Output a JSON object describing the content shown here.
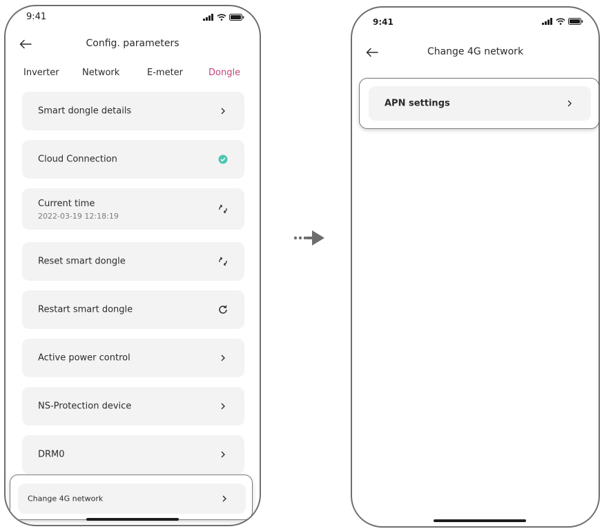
{
  "left_screen": {
    "status": {
      "time": "9:41"
    },
    "title": "Config. parameters",
    "tabs": [
      {
        "label": "Inverter",
        "active": false
      },
      {
        "label": "Network",
        "active": false
      },
      {
        "label": "E-meter",
        "active": false
      },
      {
        "label": "Dongle",
        "active": true
      }
    ],
    "items": [
      {
        "label": "Smart dongle details",
        "trailing_icon": "chevron-right"
      },
      {
        "label": "Cloud Connection",
        "trailing_icon": "check-circle"
      },
      {
        "label": "Current time",
        "value": "2022-03-19 12:18:19",
        "trailing_icon": "sync"
      },
      {
        "label": "Reset smart dongle",
        "trailing_icon": "sync"
      },
      {
        "label": "Restart smart dongle",
        "trailing_icon": "refresh"
      },
      {
        "label": "Active power control",
        "trailing_icon": "chevron-right"
      },
      {
        "label": "NS-Protection device",
        "trailing_icon": "chevron-right"
      },
      {
        "label": "DRM0",
        "trailing_icon": "chevron-right"
      },
      {
        "label": "Change 4G network",
        "trailing_icon": "chevron-right"
      }
    ]
  },
  "right_screen": {
    "status": {
      "time": "9:41"
    },
    "title": "Change 4G network",
    "items": [
      {
        "label": "APN settings",
        "trailing_icon": "chevron-right"
      }
    ]
  },
  "colors": {
    "accent": "#c4457a",
    "success": "#4cc7b0",
    "card_bg": "#f3f3f3",
    "frame": "#6d6d6d"
  }
}
